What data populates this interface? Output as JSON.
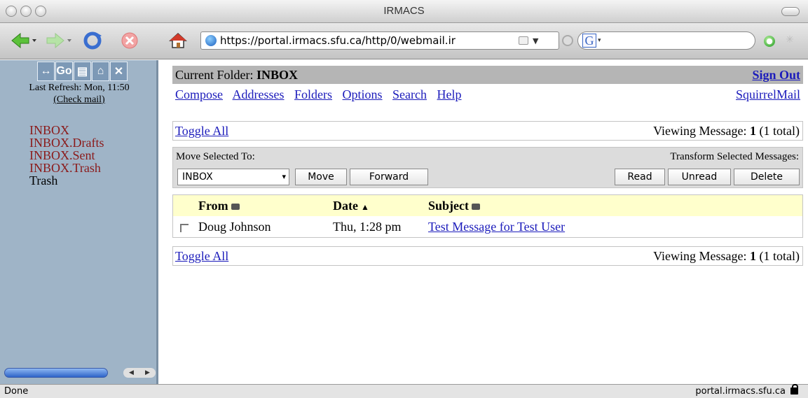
{
  "window": {
    "title": "IRMACS"
  },
  "browser": {
    "url": "https://portal.irmacs.sfu.ca/http/0/webmail.ir",
    "status_left": "Done",
    "status_right": "portal.irmacs.sfu.ca"
  },
  "sidebar": {
    "icons": [
      "↔",
      "Go",
      "▤",
      "⌂",
      "✕"
    ],
    "last_refresh": "Last Refresh: Mon, 11:50",
    "check_mail": "(Check mail)",
    "folders": [
      "INBOX",
      "INBOX.Drafts",
      "INBOX.Sent",
      "INBOX.Trash",
      "Trash"
    ]
  },
  "header": {
    "current_folder_label": "Current Folder:",
    "current_folder": "INBOX",
    "sign_out": "Sign Out",
    "nav": [
      "Compose",
      "Addresses",
      "Folders",
      "Options",
      "Search",
      "Help"
    ],
    "brand": "SquirrelMail"
  },
  "toggle_all": "Toggle All",
  "viewing": {
    "label": "Viewing Message:",
    "number": "1",
    "total": "(1 total)"
  },
  "actions": {
    "move_label": "Move Selected To:",
    "transform_label": "Transform Selected Messages:",
    "selected_folder": "INBOX",
    "move": "Move",
    "forward": "Forward",
    "read": "Read",
    "unread": "Unread",
    "delete": "Delete"
  },
  "table": {
    "headers": {
      "from": "From",
      "date": "Date",
      "subject": "Subject"
    },
    "rows": [
      {
        "from": "Doug Johnson",
        "date": "Thu, 1:28 pm",
        "subject": "Test Message for Test User"
      }
    ]
  }
}
